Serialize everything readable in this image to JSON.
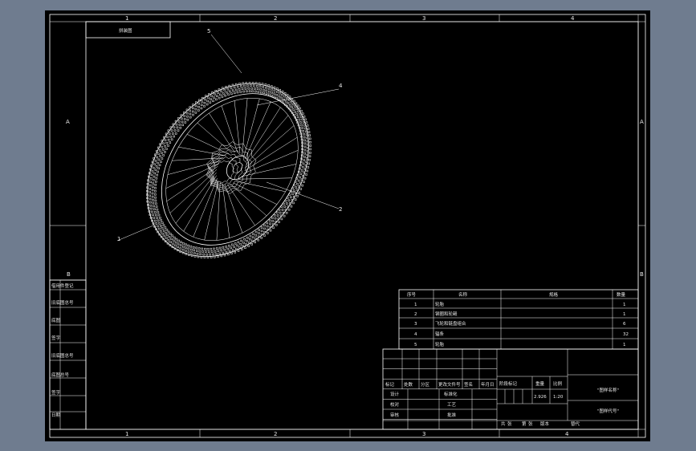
{
  "app": {
    "background_color": "#6f7c8f",
    "canvas_color": "#000000",
    "line_color": "#ffffff"
  },
  "zones": {
    "columns": [
      "1",
      "2",
      "3",
      "4"
    ],
    "rows_left": [
      "A",
      "B"
    ],
    "rows_right": [
      "A",
      "B"
    ]
  },
  "drawing_tag": "拼装图",
  "callouts": [
    "5",
    "4",
    "2",
    "1"
  ],
  "left_strip": [
    "借用件登记",
    "旧底图总号",
    "底图",
    "签字",
    "旧底图总号",
    "底图总号",
    "签字",
    "日期"
  ],
  "parts_list": {
    "headers": [
      "序号",
      "名称",
      "规格",
      "数量"
    ],
    "rows": [
      {
        "no": "1",
        "name": "轮胎",
        "qty": "1"
      },
      {
        "no": "2",
        "name": "钢圈和轮毂",
        "qty": "1"
      },
      {
        "no": "3",
        "name": "飞轮和链盘组合",
        "qty": "6"
      },
      {
        "no": "4",
        "name": "辐条",
        "qty": "32"
      },
      {
        "no": "5",
        "name": "轮胎",
        "qty": "1"
      }
    ]
  },
  "title_block": {
    "revision_headers": [
      "标记",
      "处数",
      "分区",
      "更改文件号",
      "签名",
      "年月日"
    ],
    "role_rows": [
      "设计",
      "校对",
      "审核"
    ],
    "mid_labels": [
      "标准化",
      "工艺",
      "批准"
    ],
    "stage_header": "阶段标记",
    "weight_header": "重量",
    "scale_header": "比例",
    "weight_value": "2.926",
    "scale_value": "1:20",
    "sheet_row": [
      "共",
      "张",
      "第",
      "张"
    ],
    "version_label": "版本",
    "replace_label": "替代",
    "drawing_name": "\"图样名称\"",
    "drawing_code": "\"图样代号\""
  }
}
